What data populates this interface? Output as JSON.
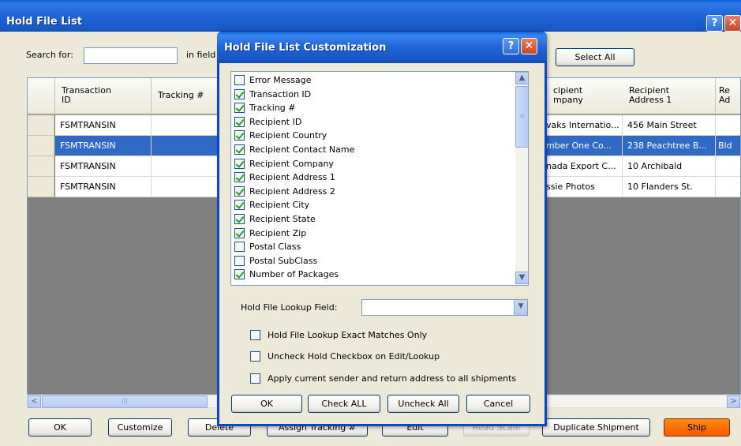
{
  "main": {
    "title": "Hold File List",
    "help_glyph": "?",
    "close_glyph": "✕",
    "search_label": "Search for:",
    "search_value": "",
    "in_field_label": "in field",
    "select_all_label": "Select All",
    "columns": [
      "Transaction ID",
      "Tracking #",
      "Recipient Company",
      "Recipient Address 1",
      "Re Ad"
    ],
    "columns_visible": {
      "transaction_id": "Transaction\nID",
      "tracking": "Tracking #",
      "company_partial": "cipient\nmpany",
      "address1": "Recipient\nAddress 1",
      "address2_partial": "Re\nAd"
    },
    "rows": [
      {
        "transaction_id": "FSMTRANSIN",
        "tracking": "",
        "company": "vaks Internatio...",
        "address1": "456 Main Street",
        "address2": "",
        "selected": false
      },
      {
        "transaction_id": "FSMTRANSIN",
        "tracking": "",
        "company": "mber One Co...",
        "address1": "238 Peachtree B...",
        "address2": "Bld",
        "selected": true
      },
      {
        "transaction_id": "FSMTRANSIN",
        "tracking": "",
        "company": "nada Export C...",
        "address1": "10 Archibald",
        "address2": "",
        "selected": false
      },
      {
        "transaction_id": "FSMTRANSIN",
        "tracking": "",
        "company": "ssie Photos",
        "address1": "10 Flanders St.",
        "address2": "",
        "selected": false
      }
    ],
    "scroll_left_glyph": "<",
    "scroll_right_glyph": ">",
    "scroll_thumb_grip": "III",
    "buttons": {
      "ok": "OK",
      "customize": "Customize",
      "delete": "Delete",
      "assign_tracking": "Assign Tracking #",
      "edit": "Edit",
      "read_scale": "Read Scale",
      "duplicate": "Duplicate Shipment",
      "ship": "Ship"
    }
  },
  "dialog": {
    "title": "Hold File List Customization",
    "help_glyph": "?",
    "close_glyph": "✕",
    "fields": [
      {
        "label": "Error Message",
        "checked": false
      },
      {
        "label": "Transaction ID",
        "checked": true
      },
      {
        "label": "Tracking #",
        "checked": true
      },
      {
        "label": "Recipient ID",
        "checked": true
      },
      {
        "label": "Recipient Country",
        "checked": true
      },
      {
        "label": "Recipient Contact Name",
        "checked": true
      },
      {
        "label": "Recipient Company",
        "checked": true
      },
      {
        "label": "Recipient Address 1",
        "checked": true
      },
      {
        "label": "Recipient Address 2",
        "checked": true
      },
      {
        "label": "Recipient City",
        "checked": true
      },
      {
        "label": "Recipient State",
        "checked": true
      },
      {
        "label": "Recipient Zip",
        "checked": true
      },
      {
        "label": "Postal Class",
        "checked": false
      },
      {
        "label": "Postal SubClass",
        "checked": false
      },
      {
        "label": "Number of Packages",
        "checked": true
      }
    ],
    "scroll_up_glyph": "▲",
    "scroll_down_glyph": "▼",
    "scroll_grip": "≡",
    "lookup_label": "Hold File Lookup Field:",
    "lookup_value": "",
    "combo_glyph": "▼",
    "options": {
      "exact_matches": {
        "label": "Hold File Lookup Exact Matches Only",
        "checked": false
      },
      "uncheck_hold": {
        "label": "Uncheck Hold Checkbox on Edit/Lookup",
        "checked": false
      },
      "apply_sender": {
        "label": "Apply current sender and return address to all shipments",
        "checked": false
      }
    },
    "buttons": {
      "ok": "OK",
      "check_all": "Check ALL",
      "uncheck_all": "Uncheck All",
      "cancel": "Cancel"
    }
  },
  "colors": {
    "titlebar": "#1e65d6",
    "selection": "#316ac5",
    "ship_button": "#ff6a00",
    "window_bg": "#ece9d8",
    "grid_empty": "#808080"
  }
}
